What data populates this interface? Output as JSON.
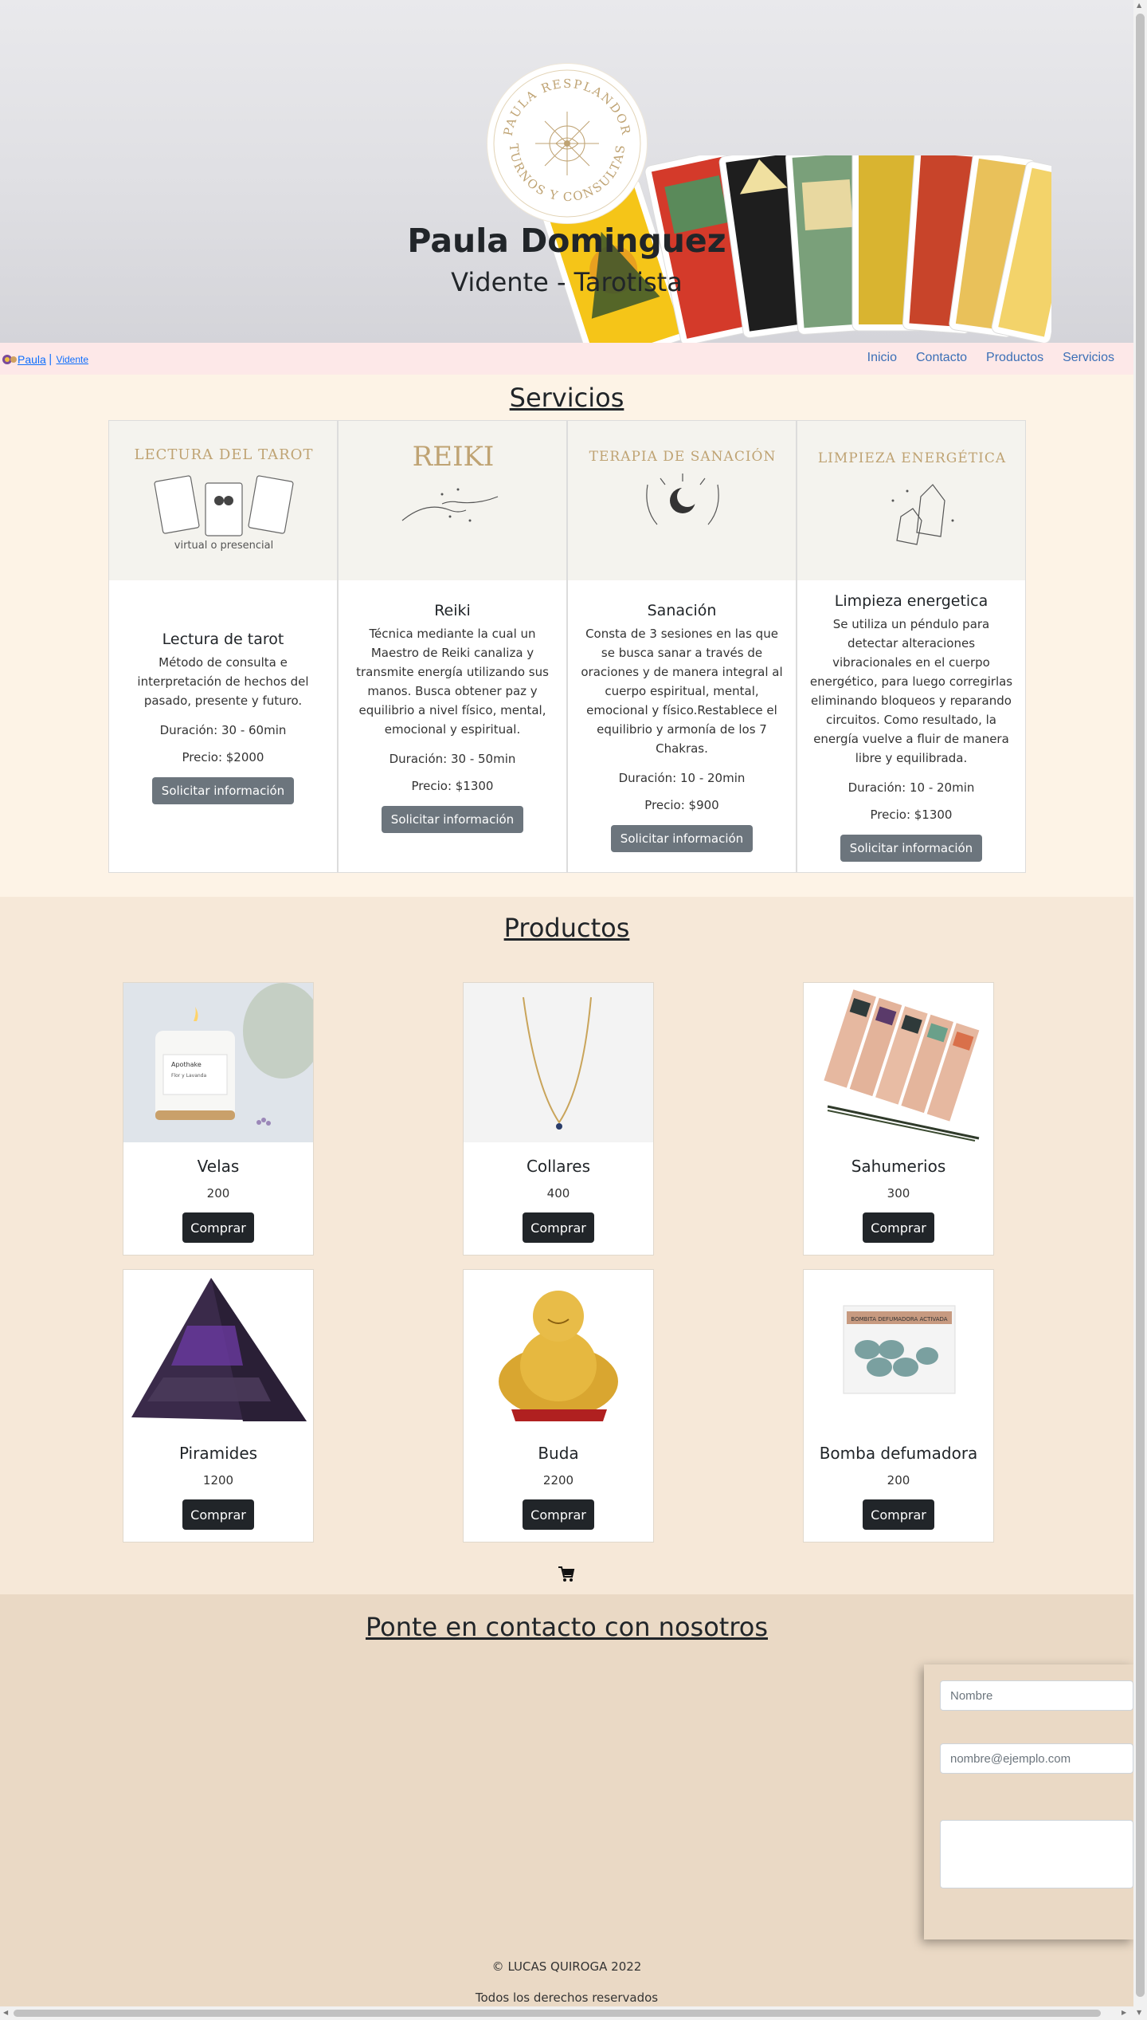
{
  "hero": {
    "logo_text": "PAULA RESPLANDOR TURNOS Y CONSULTAS",
    "name": "Paula Dominguez",
    "role": "Vidente - Tarotista"
  },
  "nav": {
    "brand_name": "Paula",
    "brand_sep": "|",
    "brand_sub": "Vidente",
    "links": [
      "Inicio",
      "Contacto",
      "Productos",
      "Servicios"
    ]
  },
  "services": {
    "title": "Servicios",
    "button_label": "Solicitar información",
    "items": [
      {
        "image_text": "LECTURA DEL TAROT",
        "image_sub": "virtual o presencial",
        "title": "Lectura de tarot",
        "description": "Método de consulta e interpretación de hechos del pasado, presente y futuro.",
        "duration": "Duración: 30 - 60min",
        "price": "Precio: $2000"
      },
      {
        "image_text": "REIKI",
        "image_sub": "",
        "title": "Reiki",
        "description": "Técnica mediante la cual un Maestro de Reiki canaliza y transmite energía utilizando sus manos. Busca obtener paz y equilibrio a nivel físico, mental, emocional y espiritual.",
        "duration": "Duración: 30 - 50min",
        "price": "Precio: $1300"
      },
      {
        "image_text": "TERAPIA DE SANACIÓN",
        "image_sub": "",
        "title": "Sanación",
        "description": "Consta de 3 sesiones en las que se busca sanar a través de oraciones y de manera integral al cuerpo espiritual, mental, emocional y físico.Restablece el equilibrio y armonía de los 7 Chakras.",
        "duration": "Duración: 10 - 20min",
        "price": "Precio: $900"
      },
      {
        "image_text": "LIMPIEZA ENERGÉTICA",
        "image_sub": "",
        "title": "Limpieza energetica",
        "description": "Se utiliza un péndulo para detectar alteraciones vibracionales en el cuerpo energético, para luego corregirlas eliminando bloqueos y reparando circuitos. Como resultado, la energía vuelve a fluir de manera libre y equilibrada.",
        "duration": "Duración: 10 - 20min",
        "price": "Precio: $1300"
      }
    ]
  },
  "products": {
    "title": "Productos",
    "buy_label": "Comprar",
    "candle_label": "Apothake",
    "candle_sub": "Flor y Lavanda",
    "bomb_label": "BOMBITA DEFUMADORA ACTIVADA",
    "items": [
      {
        "name": "Velas",
        "price": "200",
        "image": "candle"
      },
      {
        "name": "Collares",
        "price": "400",
        "image": "necklace"
      },
      {
        "name": "Sahumerios",
        "price": "300",
        "image": "incense"
      },
      {
        "name": "Piramides",
        "price": "1200",
        "image": "pyramid"
      },
      {
        "name": "Buda",
        "price": "2200",
        "image": "buddha"
      },
      {
        "name": "Bomba defumadora",
        "price": "200",
        "image": "smoke-bomb"
      }
    ]
  },
  "contact": {
    "title": "Ponte en contacto con nosotros",
    "name_placeholder": "Nombre",
    "email_placeholder": "nombre@ejemplo.com",
    "message_placeholder": ""
  },
  "footer": {
    "copyright": "© LUCAS QUIROGA 2022",
    "rights": "Todos los derechos reservados"
  },
  "colors": {
    "nav_bg": "#fde8e8",
    "services_bg": "#fdf3e6",
    "products_bg": "#f6e8d8",
    "contact_bg": "#ead9c5",
    "gold": "#bfa373",
    "link_blue": "#3b6fb6"
  }
}
